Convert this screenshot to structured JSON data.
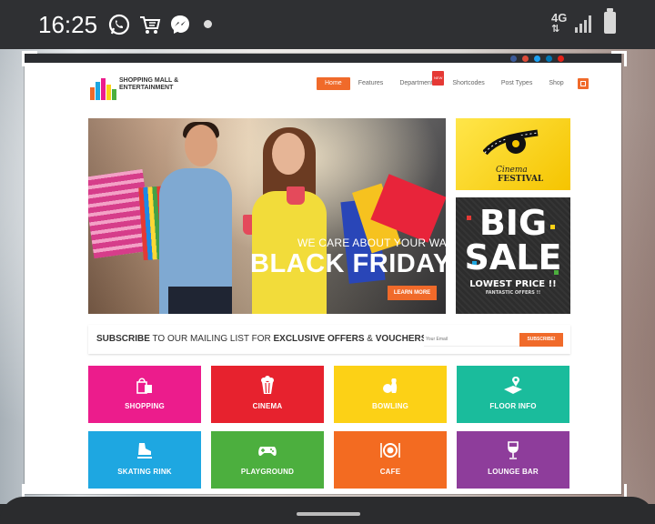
{
  "statusbar": {
    "time": "16:25",
    "network_label": "4G",
    "icons": [
      "whatsapp-icon",
      "shopping-cart-icon",
      "messenger-icon",
      "notification-dot-icon",
      "signal-icon",
      "battery-icon"
    ]
  },
  "site": {
    "logo_line1": "SHOPPING MALL &",
    "logo_line2": "ENTERTAINMENT",
    "nav": [
      "Home",
      "Features",
      "Departments",
      "Shortcodes",
      "Post Types",
      "Shop"
    ],
    "nav_badge": "NEW"
  },
  "hero": {
    "subtitle": "WE CARE ABOUT YOUR WALLET!",
    "title": "BLACK FRIDAY",
    "button": "LEARN MORE"
  },
  "promo_cinema": {
    "line1": "Cinema",
    "line2": "FESTIVAL"
  },
  "promo_sale": {
    "line1": "BIG",
    "line2": "SALE",
    "line3": "LOWEST PRICE !!",
    "line4": "FANTASTIC OFFERS !!"
  },
  "subscribe": {
    "part1": "SUBSCRIBE",
    "part2": " TO OUR MAILING LIST FOR ",
    "part3": "EXCLUSIVE OFFERS",
    "part4": " & ",
    "part5": "VOUCHERS!",
    "email_placeholder": "Your Email",
    "button": "SUBSCRIBE!"
  },
  "tiles": [
    {
      "label": "SHOPPING",
      "color": "#ec1c8c"
    },
    {
      "label": "CINEMA",
      "color": "#e7222e"
    },
    {
      "label": "BOWLING",
      "color": "#fcd116"
    },
    {
      "label": "FLOOR INFO",
      "color": "#1abc9c"
    },
    {
      "label": "SKATING RINK",
      "color": "#1ea7e1"
    },
    {
      "label": "PLAYGROUND",
      "color": "#4caf3e"
    },
    {
      "label": "CAFE",
      "color": "#f36b21"
    },
    {
      "label": "LOUNGE BAR",
      "color": "#8e3d9b"
    }
  ],
  "colors": {
    "accent": "#f06a2a",
    "statusbar": "#2f3033"
  }
}
